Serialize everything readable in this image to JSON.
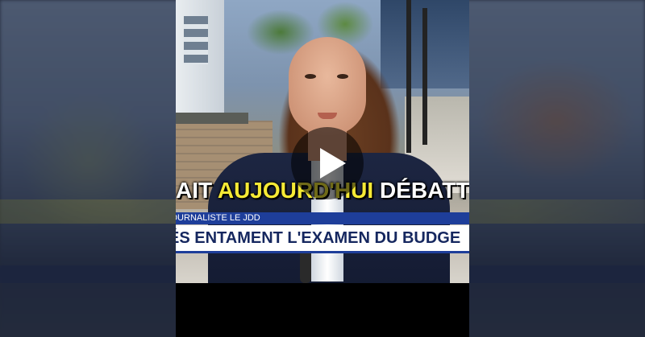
{
  "video": {
    "caption": {
      "before": "AIT ",
      "highlight": "AUJOURD'HUI",
      "after": " DÉBATT"
    },
    "lower_third": {
      "tag": "JOURNALISTE LE JDD",
      "headline": "ÉS ENTAMENT L'EXAMEN DU BUDGE"
    },
    "play_icon": "play-icon",
    "colors": {
      "caption_highlight": "#f6ea35",
      "tag_background": "#1e3e9a",
      "headline_text": "#15275f"
    }
  }
}
